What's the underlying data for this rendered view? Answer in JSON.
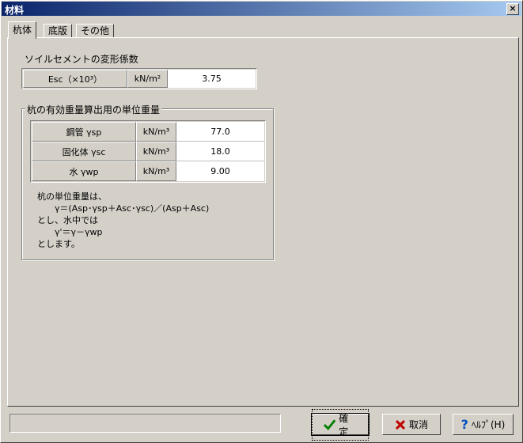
{
  "window": {
    "title": "材料",
    "close_label": "×"
  },
  "tabs": [
    {
      "label": "杭体",
      "active": true
    },
    {
      "label": "底版",
      "active": false
    },
    {
      "label": "その他",
      "active": false
    }
  ],
  "soil_cement": {
    "section_label": "ソイルセメントの変形係数",
    "row": {
      "name": "Esc（×10³）",
      "unit": "kN/m²",
      "value": "3.75"
    }
  },
  "unit_weight": {
    "group_title": "杭の有効重量算出用の単位重量",
    "rows": [
      {
        "name": "鋼管 γsp",
        "unit": "kN/m³",
        "value": "77.0"
      },
      {
        "name": "固化体 γsc",
        "unit": "kN/m³",
        "value": "18.0"
      },
      {
        "name": "水 γwp",
        "unit": "kN/m³",
        "value": "9.00"
      }
    ],
    "notes": [
      "杭の単位重量は、",
      "　　γ＝(Asp･γsp＋Asc･γsc)／(Asp＋Asc)",
      "とし、水中では",
      "　　γ'＝γ－γwp",
      "とします。"
    ]
  },
  "buttons": {
    "ok": "確定",
    "cancel": "取消",
    "help": "ﾍﾙﾌﾟ(H)"
  },
  "status_text": ""
}
